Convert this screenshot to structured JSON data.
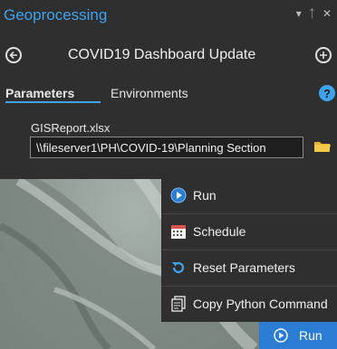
{
  "pane": {
    "title": "Geoprocessing",
    "controls": [
      "▾",
      "ᛏ",
      "✕"
    ]
  },
  "tool": {
    "title": "COVID19 Dashboard Update"
  },
  "tabs": {
    "parameters": "Parameters",
    "environments": "Environments",
    "help": "?"
  },
  "parameter": {
    "label": "GISReport.xlsx",
    "value": "\\\\fileserver1\\PH\\COVID-19\\Planning Section"
  },
  "menu": {
    "items": [
      {
        "label": "Run",
        "icon": "run-icon"
      },
      {
        "label": "Schedule",
        "icon": "calendar-icon"
      },
      {
        "label": "Reset Parameters",
        "icon": "reset-icon"
      },
      {
        "label": "Copy Python Command",
        "icon": "copy-python-icon"
      }
    ]
  },
  "run_button": {
    "label": "Run"
  },
  "colors": {
    "accent": "#3ea3f0",
    "run_button": "#2b7cd3",
    "pane_bg": "#2f2f2f"
  }
}
